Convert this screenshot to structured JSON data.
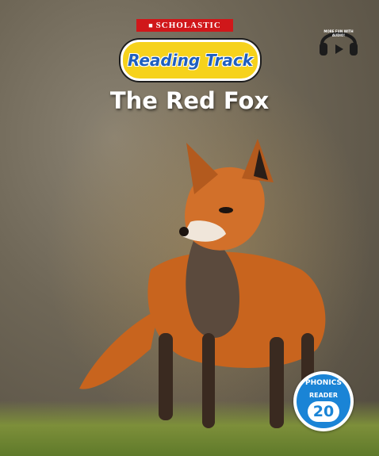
{
  "publisher": {
    "label": "SCHOLASTIC"
  },
  "series": {
    "label": "Reading Track"
  },
  "title": "The Red Fox",
  "audio_badge": {
    "label": "MORE FUN WITH AUDIO!",
    "icon": "headphones-play-icon"
  },
  "level_badge": {
    "phonics_label": "PHONICS",
    "reader_label": "READER",
    "number": "20"
  },
  "colors": {
    "publisher_red": "#d0171a",
    "series_yellow": "#f6d21c",
    "series_blue": "#1f5fbf",
    "badge_blue": "#1a84d6",
    "fox_orange": "#c8641e"
  }
}
